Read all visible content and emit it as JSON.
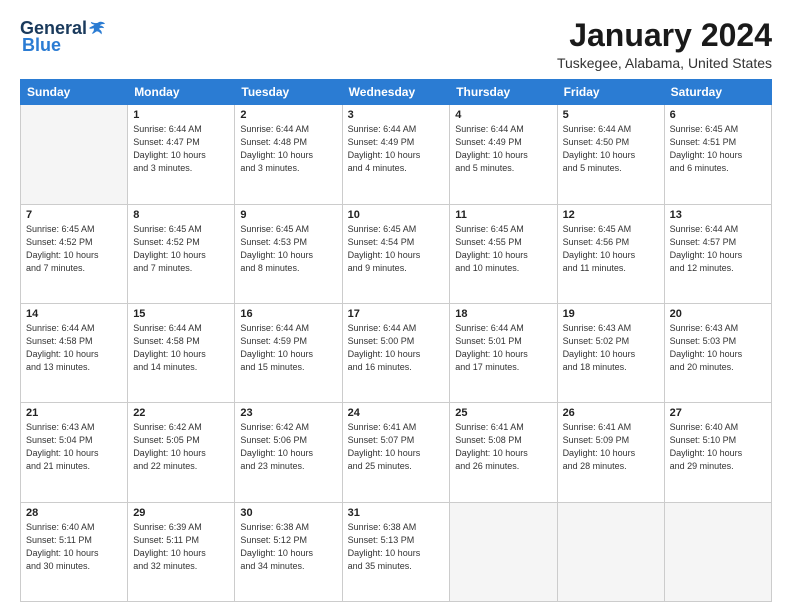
{
  "logo": {
    "general": "General",
    "blue": "Blue"
  },
  "header": {
    "month_title": "January 2024",
    "location": "Tuskegee, Alabama, United States"
  },
  "days_of_week": [
    "Sunday",
    "Monday",
    "Tuesday",
    "Wednesday",
    "Thursday",
    "Friday",
    "Saturday"
  ],
  "weeks": [
    [
      {
        "day": "",
        "text": ""
      },
      {
        "day": "1",
        "text": "Sunrise: 6:44 AM\nSunset: 4:47 PM\nDaylight: 10 hours\nand 3 minutes."
      },
      {
        "day": "2",
        "text": "Sunrise: 6:44 AM\nSunset: 4:48 PM\nDaylight: 10 hours\nand 3 minutes."
      },
      {
        "day": "3",
        "text": "Sunrise: 6:44 AM\nSunset: 4:49 PM\nDaylight: 10 hours\nand 4 minutes."
      },
      {
        "day": "4",
        "text": "Sunrise: 6:44 AM\nSunset: 4:49 PM\nDaylight: 10 hours\nand 5 minutes."
      },
      {
        "day": "5",
        "text": "Sunrise: 6:44 AM\nSunset: 4:50 PM\nDaylight: 10 hours\nand 5 minutes."
      },
      {
        "day": "6",
        "text": "Sunrise: 6:45 AM\nSunset: 4:51 PM\nDaylight: 10 hours\nand 6 minutes."
      }
    ],
    [
      {
        "day": "7",
        "text": "Sunrise: 6:45 AM\nSunset: 4:52 PM\nDaylight: 10 hours\nand 7 minutes."
      },
      {
        "day": "8",
        "text": "Sunrise: 6:45 AM\nSunset: 4:52 PM\nDaylight: 10 hours\nand 7 minutes."
      },
      {
        "day": "9",
        "text": "Sunrise: 6:45 AM\nSunset: 4:53 PM\nDaylight: 10 hours\nand 8 minutes."
      },
      {
        "day": "10",
        "text": "Sunrise: 6:45 AM\nSunset: 4:54 PM\nDaylight: 10 hours\nand 9 minutes."
      },
      {
        "day": "11",
        "text": "Sunrise: 6:45 AM\nSunset: 4:55 PM\nDaylight: 10 hours\nand 10 minutes."
      },
      {
        "day": "12",
        "text": "Sunrise: 6:45 AM\nSunset: 4:56 PM\nDaylight: 10 hours\nand 11 minutes."
      },
      {
        "day": "13",
        "text": "Sunrise: 6:44 AM\nSunset: 4:57 PM\nDaylight: 10 hours\nand 12 minutes."
      }
    ],
    [
      {
        "day": "14",
        "text": "Sunrise: 6:44 AM\nSunset: 4:58 PM\nDaylight: 10 hours\nand 13 minutes."
      },
      {
        "day": "15",
        "text": "Sunrise: 6:44 AM\nSunset: 4:58 PM\nDaylight: 10 hours\nand 14 minutes."
      },
      {
        "day": "16",
        "text": "Sunrise: 6:44 AM\nSunset: 4:59 PM\nDaylight: 10 hours\nand 15 minutes."
      },
      {
        "day": "17",
        "text": "Sunrise: 6:44 AM\nSunset: 5:00 PM\nDaylight: 10 hours\nand 16 minutes."
      },
      {
        "day": "18",
        "text": "Sunrise: 6:44 AM\nSunset: 5:01 PM\nDaylight: 10 hours\nand 17 minutes."
      },
      {
        "day": "19",
        "text": "Sunrise: 6:43 AM\nSunset: 5:02 PM\nDaylight: 10 hours\nand 18 minutes."
      },
      {
        "day": "20",
        "text": "Sunrise: 6:43 AM\nSunset: 5:03 PM\nDaylight: 10 hours\nand 20 minutes."
      }
    ],
    [
      {
        "day": "21",
        "text": "Sunrise: 6:43 AM\nSunset: 5:04 PM\nDaylight: 10 hours\nand 21 minutes."
      },
      {
        "day": "22",
        "text": "Sunrise: 6:42 AM\nSunset: 5:05 PM\nDaylight: 10 hours\nand 22 minutes."
      },
      {
        "day": "23",
        "text": "Sunrise: 6:42 AM\nSunset: 5:06 PM\nDaylight: 10 hours\nand 23 minutes."
      },
      {
        "day": "24",
        "text": "Sunrise: 6:41 AM\nSunset: 5:07 PM\nDaylight: 10 hours\nand 25 minutes."
      },
      {
        "day": "25",
        "text": "Sunrise: 6:41 AM\nSunset: 5:08 PM\nDaylight: 10 hours\nand 26 minutes."
      },
      {
        "day": "26",
        "text": "Sunrise: 6:41 AM\nSunset: 5:09 PM\nDaylight: 10 hours\nand 28 minutes."
      },
      {
        "day": "27",
        "text": "Sunrise: 6:40 AM\nSunset: 5:10 PM\nDaylight: 10 hours\nand 29 minutes."
      }
    ],
    [
      {
        "day": "28",
        "text": "Sunrise: 6:40 AM\nSunset: 5:11 PM\nDaylight: 10 hours\nand 30 minutes."
      },
      {
        "day": "29",
        "text": "Sunrise: 6:39 AM\nSunset: 5:11 PM\nDaylight: 10 hours\nand 32 minutes."
      },
      {
        "day": "30",
        "text": "Sunrise: 6:38 AM\nSunset: 5:12 PM\nDaylight: 10 hours\nand 34 minutes."
      },
      {
        "day": "31",
        "text": "Sunrise: 6:38 AM\nSunset: 5:13 PM\nDaylight: 10 hours\nand 35 minutes."
      },
      {
        "day": "",
        "text": ""
      },
      {
        "day": "",
        "text": ""
      },
      {
        "day": "",
        "text": ""
      }
    ]
  ]
}
